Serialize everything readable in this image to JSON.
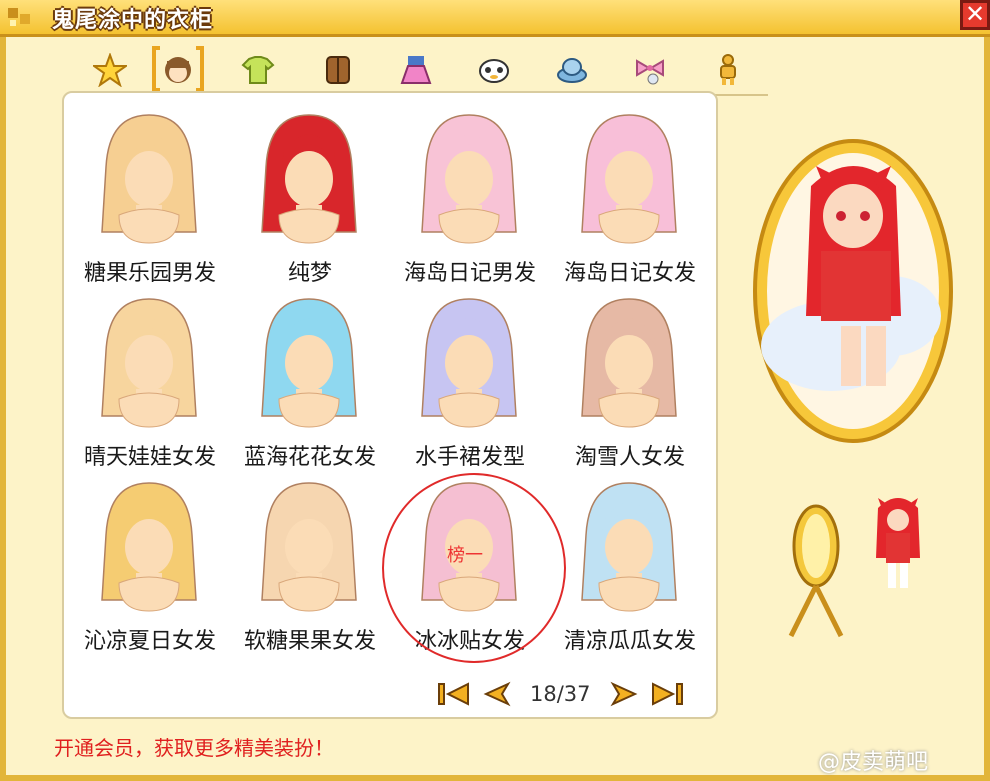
{
  "window": {
    "title": "鬼尾涂中的衣柜",
    "close_icon": "✕"
  },
  "tabs": [
    {
      "name": "star-icon",
      "active": false
    },
    {
      "name": "hair-icon",
      "active": true
    },
    {
      "name": "shirt-icon",
      "active": false
    },
    {
      "name": "coat-icon",
      "active": false
    },
    {
      "name": "skirt-icon",
      "active": false
    },
    {
      "name": "face-icon",
      "active": false
    },
    {
      "name": "hat-icon",
      "active": false
    },
    {
      "name": "bow-icon",
      "active": false
    },
    {
      "name": "body-icon",
      "active": false
    }
  ],
  "items": [
    {
      "label": "糖果乐园男发",
      "color": "#f6cf92"
    },
    {
      "label": "纯梦",
      "color": "#d8262b"
    },
    {
      "label": "海岛日记男发",
      "color": "#f8c3d6"
    },
    {
      "label": "海岛日记女发",
      "color": "#f8bfd8"
    },
    {
      "label": "晴天娃娃女发",
      "color": "#f7d59e"
    },
    {
      "label": "蓝海花花女发",
      "color": "#8fd8f0"
    },
    {
      "label": "水手裙发型",
      "color": "#c7c5f2"
    },
    {
      "label": "淘雪人女发",
      "color": "#e6b9a5"
    },
    {
      "label": "沁凉夏日女发",
      "color": "#f5cc72"
    },
    {
      "label": "软糖果果女发",
      "color": "#f6d6b0"
    },
    {
      "label": "冰冰贴女发",
      "color": "#f5bfd2"
    },
    {
      "label": "清凉瓜瓜女发",
      "color": "#bfe1f3"
    }
  ],
  "highlight": {
    "rank_label": "榜一"
  },
  "pager": {
    "page_text": "18/37"
  },
  "vip_text": "开通会员，获取更多精美装扮！",
  "watermark": "@皮卖萌吧"
}
